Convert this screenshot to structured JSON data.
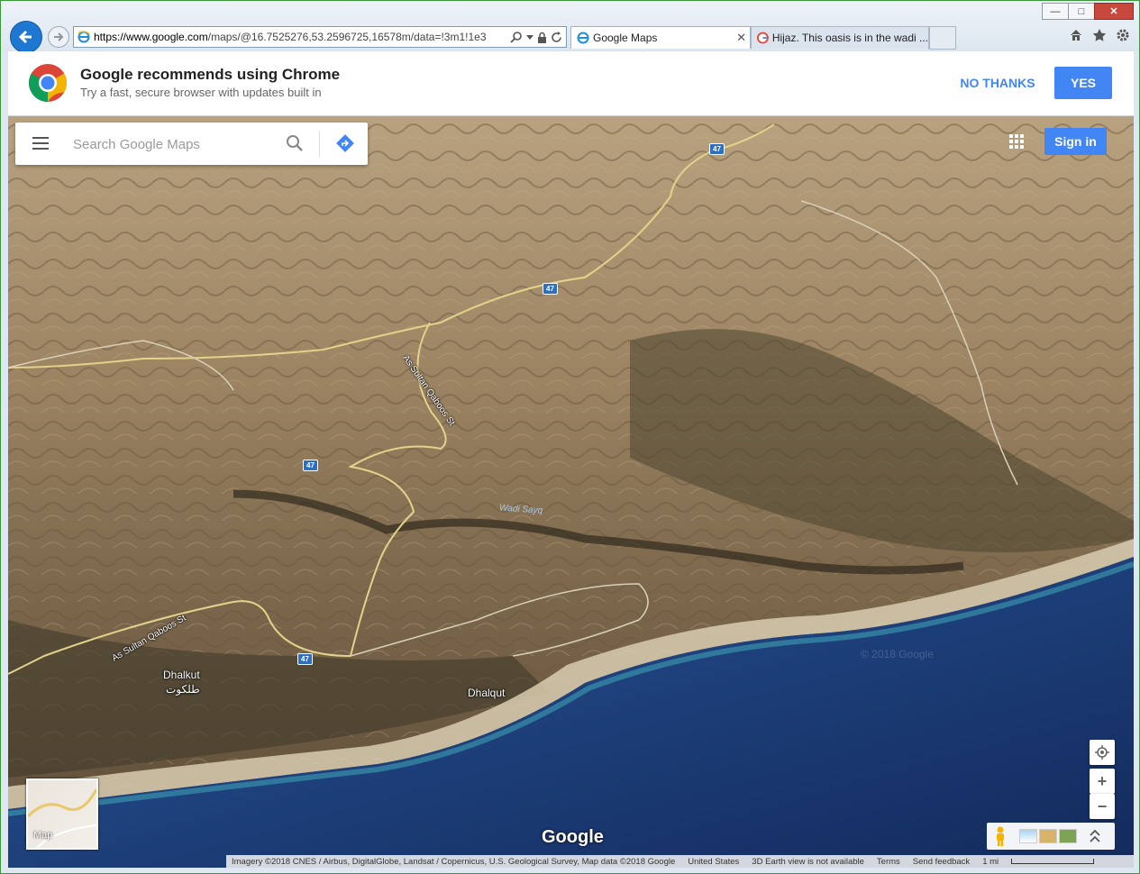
{
  "browser": {
    "url_host": "https://www.google.com",
    "url_rest": "/maps/@16.7525276,53.2596725,16578m/data=!3m1!1e3",
    "tabs": [
      {
        "label": "Google Maps",
        "active": true
      },
      {
        "label": "Hijaz. This oasis is in the wadi ...",
        "active": false
      }
    ],
    "window_controls": {
      "minimize": "—",
      "maximize": "□",
      "close": "✕"
    }
  },
  "promo": {
    "title": "Google recommends using Chrome",
    "subtitle": "Try a fast, secure browser with updates built in",
    "no_thanks": "NO THANKS",
    "yes": "YES"
  },
  "search": {
    "placeholder": "Search Google Maps"
  },
  "header": {
    "sign_in": "Sign in"
  },
  "map": {
    "route_shields": [
      "47",
      "47",
      "47",
      "47"
    ],
    "places": [
      {
        "name": "Dhalkut"
      },
      {
        "name": "طلكوت"
      },
      {
        "name": "Dhalqut"
      }
    ],
    "streets": [
      "As Sultan Qaboos St",
      "As Sultan Qaboos St"
    ],
    "wadi": "Wadi Sayq",
    "watermark": "© 2018 Google",
    "minimap_label": "Map",
    "google_logo": "Google",
    "zoom_in": "+",
    "zoom_out": "−"
  },
  "attribution": {
    "imagery": "Imagery ©2018 CNES / Airbus, DigitalGlobe, Landsat / Copernicus, U.S. Geological Survey, Map data ©2018 Google",
    "country": "United States",
    "earth": "3D Earth view is not available",
    "terms": "Terms",
    "feedback": "Send feedback",
    "scale": "1 mi"
  },
  "colors": {
    "accent": "#4285f4",
    "route_shield": "#2e6fc6",
    "sea": "#1f3f78",
    "land": "#8a7458"
  }
}
